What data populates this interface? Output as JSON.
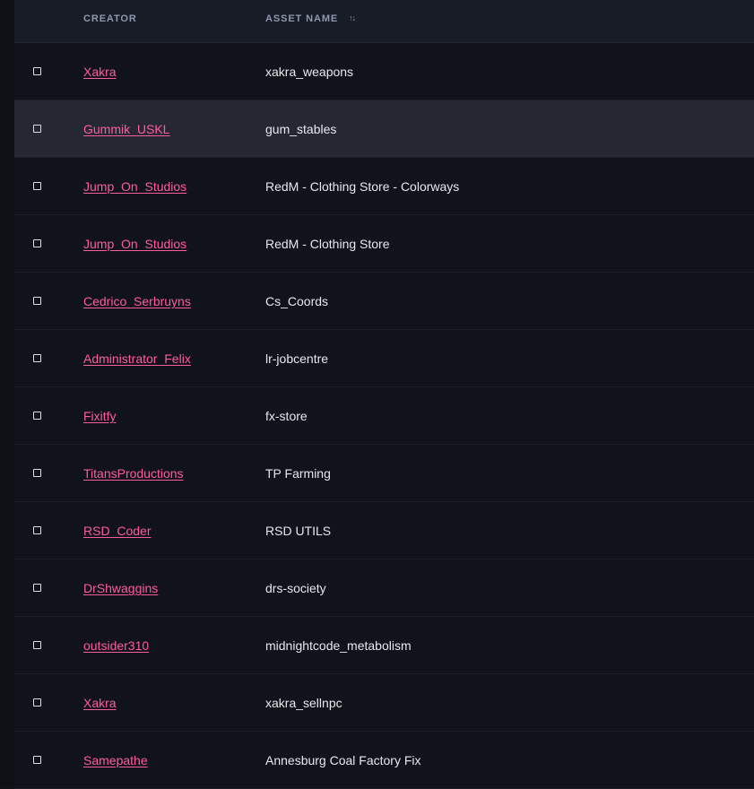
{
  "header": {
    "creator_label": "CREATOR",
    "asset_label": "ASSET NAME",
    "sort_icon": "sort-arrows-icon",
    "sort_glyph": "↑↓"
  },
  "colors": {
    "background": "#10131a",
    "header_bg": "#181c27",
    "highlight_row": "#252833",
    "link": "#ff5c9d",
    "text": "#e6e8ee",
    "header_text": "#8e98ab"
  },
  "rows": [
    {
      "creator": "Xakra",
      "asset": "xakra_weapons",
      "highlighted": false
    },
    {
      "creator": "Gummik_USKL",
      "asset": "gum_stables",
      "highlighted": true
    },
    {
      "creator": "Jump_On_Studios",
      "asset": "RedM - Clothing Store - Colorways",
      "highlighted": false
    },
    {
      "creator": "Jump_On_Studios",
      "asset": "RedM - Clothing Store",
      "highlighted": false
    },
    {
      "creator": "Cedrico_Serbruyns",
      "asset": "Cs_Coords",
      "highlighted": false
    },
    {
      "creator": "Administrator_Felix",
      "asset": "lr-jobcentre",
      "highlighted": false
    },
    {
      "creator": "Fixitfy",
      "asset": "fx-store",
      "highlighted": false
    },
    {
      "creator": "TitansProductions",
      "asset": "TP Farming",
      "highlighted": false
    },
    {
      "creator": "RSD_Coder",
      "asset": "RSD UTILS",
      "highlighted": false
    },
    {
      "creator": "DrShwaggins",
      "asset": "drs-society",
      "highlighted": false
    },
    {
      "creator": "outsider310",
      "asset": "midnightcode_metabolism",
      "highlighted": false
    },
    {
      "creator": "Xakra",
      "asset": "xakra_sellnpc",
      "highlighted": false
    },
    {
      "creator": "Samepathe",
      "asset": "Annesburg Coal Factory Fix",
      "highlighted": false
    }
  ]
}
